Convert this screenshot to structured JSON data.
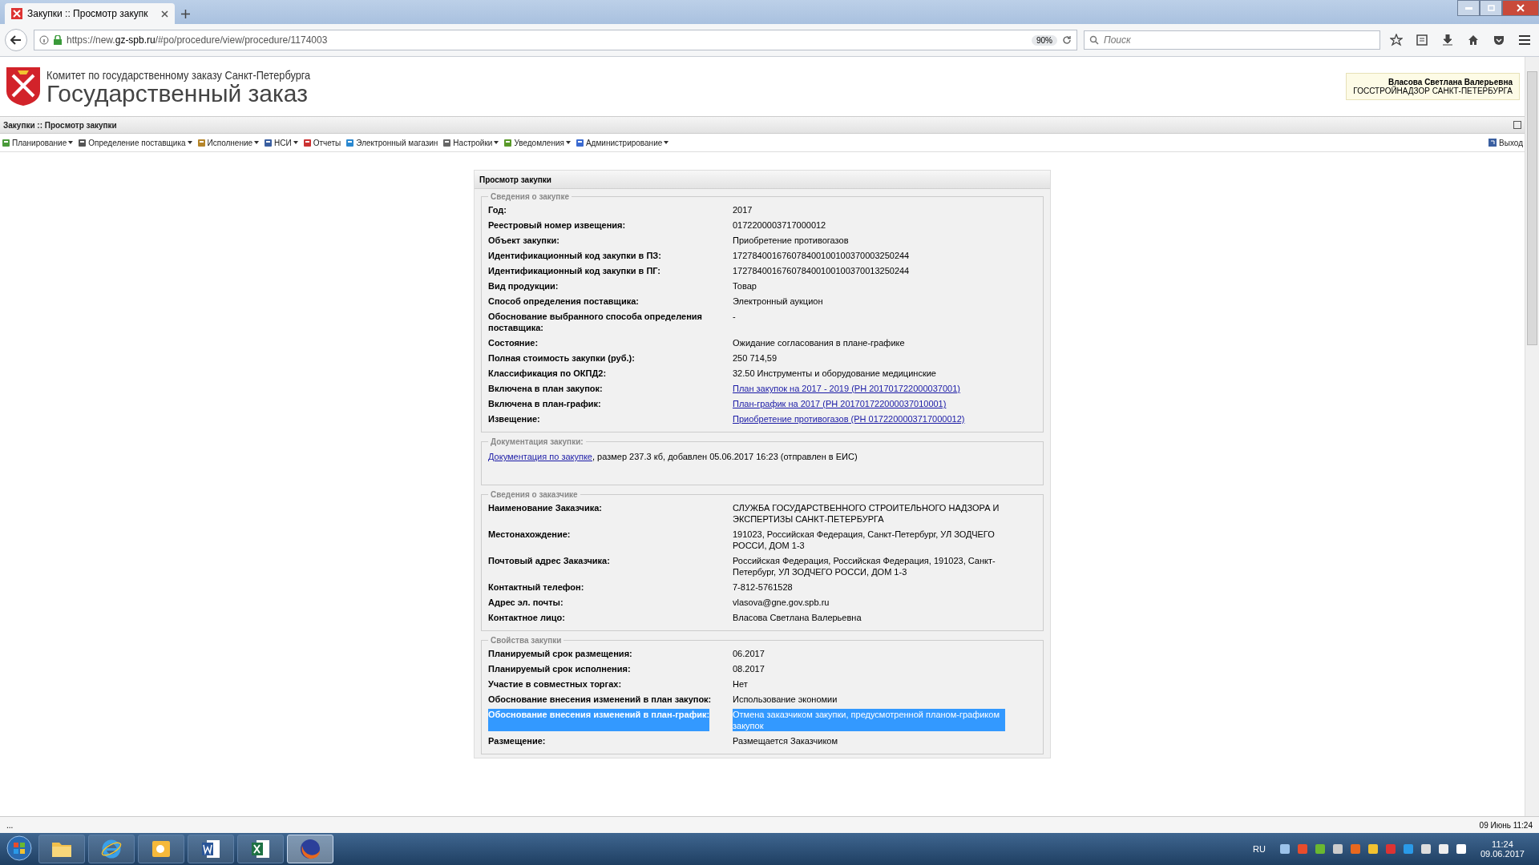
{
  "browser": {
    "tab_title": "Закупки :: Просмотр закупк",
    "url_prefix": "https://new.",
    "url_host": "gz-spb.ru",
    "url_path": "/#po/procedure/view/procedure/1174003",
    "zoom": "90%",
    "search_placeholder": "Поиск"
  },
  "header": {
    "org_line": "Комитет по государственному заказу Санкт-Петербурга",
    "title": "Государственный заказ",
    "user_name": "Власова Светлана Валерьевна",
    "user_org": "ГОССТРОЙНАДЗОР САНКТ-ПЕТЕРБУРГА"
  },
  "breadcrumb": "Закупки :: Просмотр закупки",
  "menu": [
    {
      "label": "Планирование",
      "dropdown": true
    },
    {
      "label": "Определение поставщика",
      "dropdown": true
    },
    {
      "label": "Исполнение",
      "dropdown": true
    },
    {
      "label": "НСИ",
      "dropdown": true
    },
    {
      "label": "Отчеты",
      "dropdown": false
    },
    {
      "label": "Электронный магазин",
      "dropdown": false
    },
    {
      "label": "Настройки",
      "dropdown": true
    },
    {
      "label": "Уведомления",
      "dropdown": true
    },
    {
      "label": "Администрирование",
      "dropdown": true
    }
  ],
  "logout": "Выход",
  "panel": {
    "title": "Просмотр закупки",
    "sections": [
      {
        "kind": "fields",
        "legend": "Сведения о закупке",
        "rows": [
          {
            "label": "Год:",
            "value": "2017",
            "kind": "text",
            "highlighted": false
          },
          {
            "label": "Реестровый номер извещения:",
            "value": "0172200003717000012",
            "kind": "text",
            "highlighted": false
          },
          {
            "label": "Объект закупки:",
            "value": "Приобретение противогазов",
            "kind": "text",
            "highlighted": false
          },
          {
            "label": "Идентификационный код закупки в ПЗ:",
            "value": "172784001676078400100100370003250244",
            "kind": "text",
            "highlighted": false
          },
          {
            "label": "Идентификационный код закупки в ПГ:",
            "value": "172784001676078400100100370013250244",
            "kind": "text",
            "highlighted": false
          },
          {
            "label": "Вид продукции:",
            "value": "Товар",
            "kind": "text",
            "highlighted": false
          },
          {
            "label": "Способ определения поставщика:",
            "value": "Электронный аукцион",
            "kind": "text",
            "highlighted": false
          },
          {
            "label": "Обоснование выбранного способа определения поставщика:",
            "value": "-",
            "kind": "text",
            "highlighted": false
          },
          {
            "label": "Состояние:",
            "value": "Ожидание согласования в плане-графике",
            "kind": "text",
            "highlighted": false
          },
          {
            "label": "Полная стоимость закупки (руб.):",
            "value": "250 714,59",
            "kind": "text",
            "highlighted": false
          },
          {
            "label": "Классификация по ОКПД2:",
            "value": "32.50 Инструменты и оборудование медицинские",
            "kind": "text",
            "highlighted": false
          },
          {
            "label": "Включена в план закупок:",
            "value": "План закупок на 2017 - 2019 (РН 201701722000037001)",
            "kind": "link",
            "highlighted": false
          },
          {
            "label": "Включена в план-график:",
            "value": "План-график на 2017 (РН 201701722000037010001)",
            "kind": "link",
            "highlighted": false
          },
          {
            "label": "Извещение:",
            "value": "Приобретение противогазов (РН 0172200003717000012)",
            "kind": "link",
            "highlighted": false
          }
        ]
      },
      {
        "kind": "document",
        "legend": "Документация закупки:",
        "link": "Документация по закупке",
        "text": ", размер 237.3 кб, добавлен 05.06.2017 16:23 (отправлен в ЕИС)"
      },
      {
        "kind": "fields",
        "legend": "Сведения о заказчике",
        "rows": [
          {
            "label": "Наименование Заказчика:",
            "value": "СЛУЖБА ГОСУДАРСТВЕННОГО СТРОИТЕЛЬНОГО НАДЗОРА И ЭКСПЕРТИЗЫ САНКТ-ПЕТЕРБУРГА",
            "kind": "text",
            "highlighted": false
          },
          {
            "label": "Местонахождение:",
            "value": "191023, Российская Федерация, Санкт-Петербург, УЛ ЗОДЧЕГО РОССИ, ДОМ 1-3",
            "kind": "text",
            "highlighted": false
          },
          {
            "label": "Почтовый адрес Заказчика:",
            "value": "Российская Федерация, Российская Федерация, 191023, Санкт-Петербург, УЛ ЗОДЧЕГО РОССИ, ДОМ 1-3",
            "kind": "text",
            "highlighted": false
          },
          {
            "label": "Контактный телефон:",
            "value": "7-812-5761528",
            "kind": "text",
            "highlighted": false
          },
          {
            "label": "Адрес эл. почты:",
            "value": "vlasova@gne.gov.spb.ru",
            "kind": "text",
            "highlighted": false
          },
          {
            "label": "Контактное лицо:",
            "value": "Власова Светлана Валерьевна",
            "kind": "text",
            "highlighted": false
          }
        ]
      },
      {
        "kind": "fields",
        "legend": "Свойства закупки",
        "rows": [
          {
            "label": "Планируемый срок размещения:",
            "value": "06.2017",
            "kind": "text",
            "highlighted": false
          },
          {
            "label": "Планируемый срок исполнения:",
            "value": "08.2017",
            "kind": "text",
            "highlighted": false
          },
          {
            "label": "Участие в совместных торгах:",
            "value": "Нет",
            "kind": "text",
            "highlighted": false
          },
          {
            "label": "Обоснование внесения изменений в план закупок:",
            "value": "Использование экономии",
            "kind": "text",
            "highlighted": false
          },
          {
            "label": "Обоснование внесения изменений в план-график:",
            "value": "Отмена заказчиком закупки, предусмотренной планом-графиком закупок",
            "kind": "text",
            "highlighted": true
          },
          {
            "label": "Размещение:",
            "value": "Размещается Заказчиком",
            "kind": "text",
            "highlighted": false
          }
        ]
      }
    ]
  },
  "status_bar": {
    "left": "...",
    "right": "09 Июнь 11:24"
  },
  "taskbar": {
    "apps": [
      {
        "kind": "explorer",
        "selected": false
      },
      {
        "kind": "ie",
        "selected": false
      },
      {
        "kind": "outlook",
        "selected": false
      },
      {
        "kind": "word",
        "selected": false
      },
      {
        "kind": "excel",
        "selected": false
      },
      {
        "kind": "firefox",
        "selected": true
      }
    ],
    "language": "RU",
    "time": "11:24",
    "date": "09.06.2017"
  }
}
